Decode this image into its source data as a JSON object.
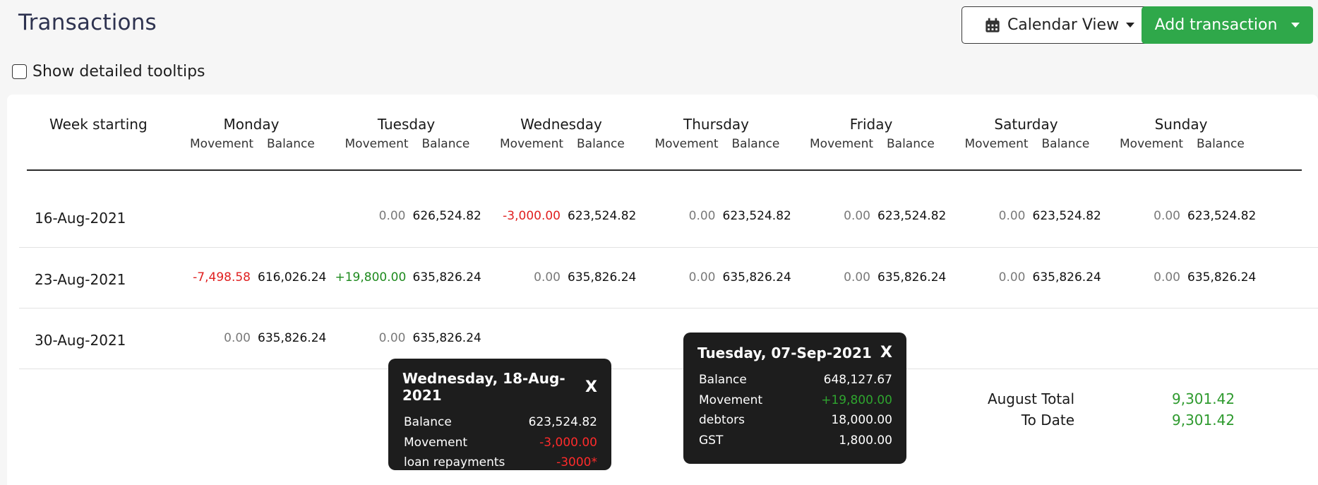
{
  "page": {
    "title": "Transactions"
  },
  "toolbar": {
    "calendar_view_label": "Calendar View",
    "add_transaction_label": "Add transaction"
  },
  "options": {
    "detailed_tooltips_label": "Show detailed tooltips",
    "detailed_tooltips_checked": false
  },
  "table": {
    "week_header": "Week starting",
    "movement_label": "Movement",
    "balance_label": "Balance",
    "days": [
      "Monday",
      "Tuesday",
      "Wednesday",
      "Thursday",
      "Friday",
      "Saturday",
      "Sunday"
    ],
    "rows": [
      {
        "week": "16-Aug-2021",
        "cells": [
          null,
          {
            "movement": "0.00",
            "balance": "626,524.82",
            "tone": "zero"
          },
          {
            "movement": "-3,000.00",
            "balance": "623,524.82",
            "tone": "neg"
          },
          {
            "movement": "0.00",
            "balance": "623,524.82",
            "tone": "zero"
          },
          {
            "movement": "0.00",
            "balance": "623,524.82",
            "tone": "zero"
          },
          {
            "movement": "0.00",
            "balance": "623,524.82",
            "tone": "zero"
          },
          {
            "movement": "0.00",
            "balance": "623,524.82",
            "tone": "zero"
          }
        ]
      },
      {
        "week": "23-Aug-2021",
        "cells": [
          {
            "movement": "-7,498.58",
            "balance": "616,026.24",
            "tone": "neg"
          },
          {
            "movement": "+19,800.00",
            "balance": "635,826.24",
            "tone": "pos"
          },
          {
            "movement": "0.00",
            "balance": "635,826.24",
            "tone": "zero"
          },
          {
            "movement": "0.00",
            "balance": "635,826.24",
            "tone": "zero"
          },
          {
            "movement": "0.00",
            "balance": "635,826.24",
            "tone": "zero"
          },
          {
            "movement": "0.00",
            "balance": "635,826.24",
            "tone": "zero"
          },
          {
            "movement": "0.00",
            "balance": "635,826.24",
            "tone": "zero"
          }
        ]
      },
      {
        "week": "30-Aug-2021",
        "cells": [
          {
            "movement": "0.00",
            "balance": "635,826.24",
            "tone": "zero"
          },
          {
            "movement": "0.00",
            "balance": "635,826.24",
            "tone": "zero"
          },
          null,
          null,
          null,
          null,
          null
        ]
      }
    ]
  },
  "totals": {
    "month_label": "August Total",
    "month_value": "9,301.42",
    "to_date_label": "To Date",
    "to_date_value": "9,301.42"
  },
  "tooltips": [
    {
      "title": "Wednesday, 18-Aug-2021",
      "close": "X",
      "rows": [
        {
          "label": "Balance",
          "value": "623,524.82",
          "tone": "plain"
        },
        {
          "label": "Movement",
          "value": "-3,000.00",
          "tone": "neg"
        },
        {
          "label": "loan repayments",
          "value": "-3000*",
          "tone": "neg"
        }
      ]
    },
    {
      "title": "Tuesday, 07-Sep-2021",
      "close": "X",
      "rows": [
        {
          "label": "Balance",
          "value": "648,127.67",
          "tone": "plain"
        },
        {
          "label": "Movement",
          "value": "+19,800.00",
          "tone": "pos"
        },
        {
          "label": "debtors",
          "value": "18,000.00",
          "tone": "plain"
        },
        {
          "label": "GST",
          "value": "1,800.00",
          "tone": "plain"
        }
      ]
    }
  ],
  "colors": {
    "accent_green": "#2fa84a",
    "negative_red": "#e02020",
    "positive_green": "#1e8a1e",
    "tooltip_bg": "#1d1d1d"
  },
  "icons": {
    "calendar_view": "calendar-icon",
    "dropdown": "caret-down-icon"
  }
}
